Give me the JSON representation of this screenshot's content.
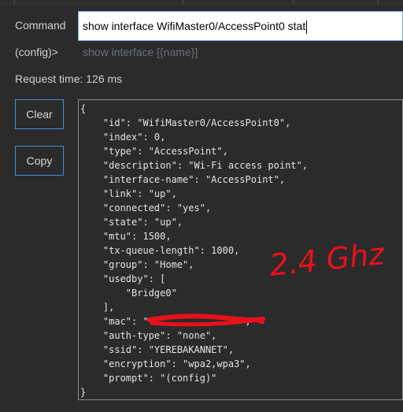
{
  "command": {
    "label": "Command",
    "value": "show interface WifiMaster0/AccessPoint0 stat"
  },
  "context": {
    "label": "(config)>",
    "hint": "show interface [{name}]"
  },
  "request_time": "Request time: 126 ms",
  "buttons": {
    "clear": "Clear",
    "copy": "Copy"
  },
  "output": {
    "text": "{\n    \"id\": \"WifiMaster0/AccessPoint0\",\n    \"index\": 0,\n    \"type\": \"AccessPoint\",\n    \"description\": \"Wi-Fi access point\",\n    \"interface-name\": \"AccessPoint\",\n    \"link\": \"up\",\n    \"connected\": \"yes\",\n    \"state\": \"up\",\n    \"mtu\": 1500,\n    \"tx-queue-length\": 1000,\n    \"group\": \"Home\",\n    \"usedby\": [\n        \"Bridge0\"\n    ],\n    \"mac\": \"                \",\n    \"auth-type\": \"none\",\n    \"ssid\": \"YEREBAKANNET\",\n    \"encryption\": \"wpa2,wpa3\",\n    \"prompt\": \"(config)\"\n}"
  },
  "annotation": {
    "text": "2.4 Ghz",
    "color": "#e8111a"
  },
  "redaction_color": "#e8111a"
}
